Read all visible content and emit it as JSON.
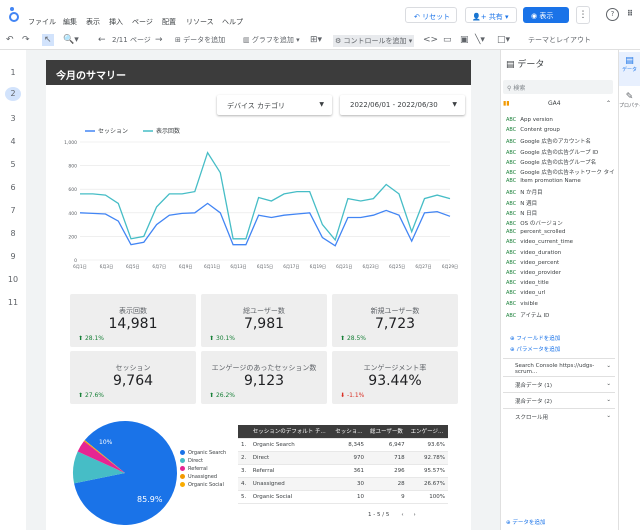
{
  "menu": {
    "items": [
      "ファイル",
      "編集",
      "表示",
      "挿入",
      "ページ",
      "配置",
      "リソース",
      "ヘルプ"
    ]
  },
  "topbar": {
    "reset": "リセット",
    "share": "共有",
    "view": "表示"
  },
  "toolbar": {
    "page": "2/11 ページ",
    "add_data": "データを追加",
    "add_chart": "グラフを追加",
    "add_control": "コントロールを追加",
    "theme": "テーマとレイアウト"
  },
  "rows": [
    "1",
    "2",
    "3",
    "4",
    "5",
    "6",
    "7",
    "8",
    "9",
    "10",
    "11"
  ],
  "report": {
    "title": "今月のサマリー",
    "device_dropdown": "デバイス カテゴリ",
    "date_range": "2022/06/01 - 2022/06/30",
    "kpis": [
      {
        "label": "表示回数",
        "value": "14,981",
        "delta": "28.1%",
        "dir": "up"
      },
      {
        "label": "総ユーザー数",
        "value": "7,981",
        "delta": "30.1%",
        "dir": "up"
      },
      {
        "label": "新規ユーザー数",
        "value": "7,723",
        "delta": "28.5%",
        "dir": "up"
      },
      {
        "label": "セッション",
        "value": "9,764",
        "delta": "27.6%",
        "dir": "up"
      },
      {
        "label": "エンゲージのあったセッション数",
        "value": "9,123",
        "delta": "26.2%",
        "dir": "up"
      },
      {
        "label": "エンゲージメント率",
        "value": "93.44%",
        "delta": "-1.1%",
        "dir": "down"
      }
    ],
    "pie_labels": {
      "big": "85.9%",
      "small": "10%"
    },
    "table": {
      "headers": [
        "",
        "セッションのデフォルト チ...",
        "セッショ...",
        "総ユーザー数",
        "エンゲージ..."
      ],
      "rows": [
        [
          "1.",
          "Organic Search",
          "8,345",
          "6,947",
          "93.6%"
        ],
        [
          "2.",
          "Direct",
          "970",
          "718",
          "92.78%"
        ],
        [
          "3.",
          "Referral",
          "361",
          "296",
          "95.57%"
        ],
        [
          "4.",
          "Unassigned",
          "30",
          "28",
          "26.67%"
        ],
        [
          "5.",
          "Organic Social",
          "10",
          "9",
          "100%"
        ]
      ],
      "pagination": "1 - 5 / 5"
    }
  },
  "chart_data": [
    {
      "type": "line",
      "x": [
        "6月1日",
        "6月3日",
        "6月5日",
        "6月7日",
        "6月9日",
        "6月11日",
        "6月13日",
        "6月15日",
        "6月17日",
        "6月19日",
        "6月21日",
        "6月23日",
        "6月25日",
        "6月27日",
        "6月29日"
      ],
      "xpoints": 30,
      "series": [
        {
          "name": "セッション",
          "color": "#4285f4",
          "values": [
            400,
            395,
            390,
            330,
            130,
            150,
            300,
            380,
            395,
            400,
            480,
            400,
            130,
            130,
            380,
            360,
            380,
            390,
            400,
            190,
            120,
            360,
            360,
            380,
            420,
            380,
            160,
            400,
            410,
            370
          ]
        },
        {
          "name": "表示回数",
          "color": "#46bdc6",
          "values": [
            560,
            560,
            550,
            480,
            180,
            200,
            450,
            560,
            560,
            580,
            910,
            740,
            180,
            180,
            530,
            500,
            560,
            580,
            580,
            300,
            170,
            520,
            500,
            520,
            640,
            560,
            240,
            520,
            550,
            520
          ]
        }
      ],
      "ylim": [
        0,
        1000
      ],
      "yticks": [
        "0",
        "200",
        "400",
        "600",
        "800",
        "1,000"
      ]
    },
    {
      "type": "pie",
      "categories": [
        "Organic Search",
        "Direct",
        "Referral",
        "Unassigned",
        "Organic Social"
      ],
      "values": [
        85.9,
        10,
        3.7,
        0.3,
        0.1
      ],
      "colors": [
        "#1a73e8",
        "#46bdc6",
        "#e52592",
        "#f29900",
        "#f9ab00"
      ]
    }
  ],
  "panel": {
    "title": "データ",
    "search": "検索",
    "source": "GA4",
    "fields": [
      "App version",
      "Content group",
      "Google 広告のアカウント名",
      "Google 広告の広告グループ ID",
      "Google 広告の広告グループ名",
      "Google 広告の広告ネットワーク タイ...",
      "Item promotion Name",
      "N か月目",
      "N 週目",
      "N 日目",
      "OS のバージョン",
      "percent_scrolled",
      "video_current_time",
      "video_duration",
      "video_percent",
      "video_provider",
      "video_title",
      "video_url",
      "visible",
      "アイテム ID"
    ],
    "add_field": "フィールドを追加",
    "add_param": "パラメータを追加",
    "sc": "Search Console https://udgs-scrum...",
    "blend1": "混合データ (1)",
    "blend2": "混合データ (2)",
    "scroll": "スクロール用",
    "add_data": "データを追加"
  },
  "rail": {
    "data": "データ",
    "props": "プロパティ"
  }
}
